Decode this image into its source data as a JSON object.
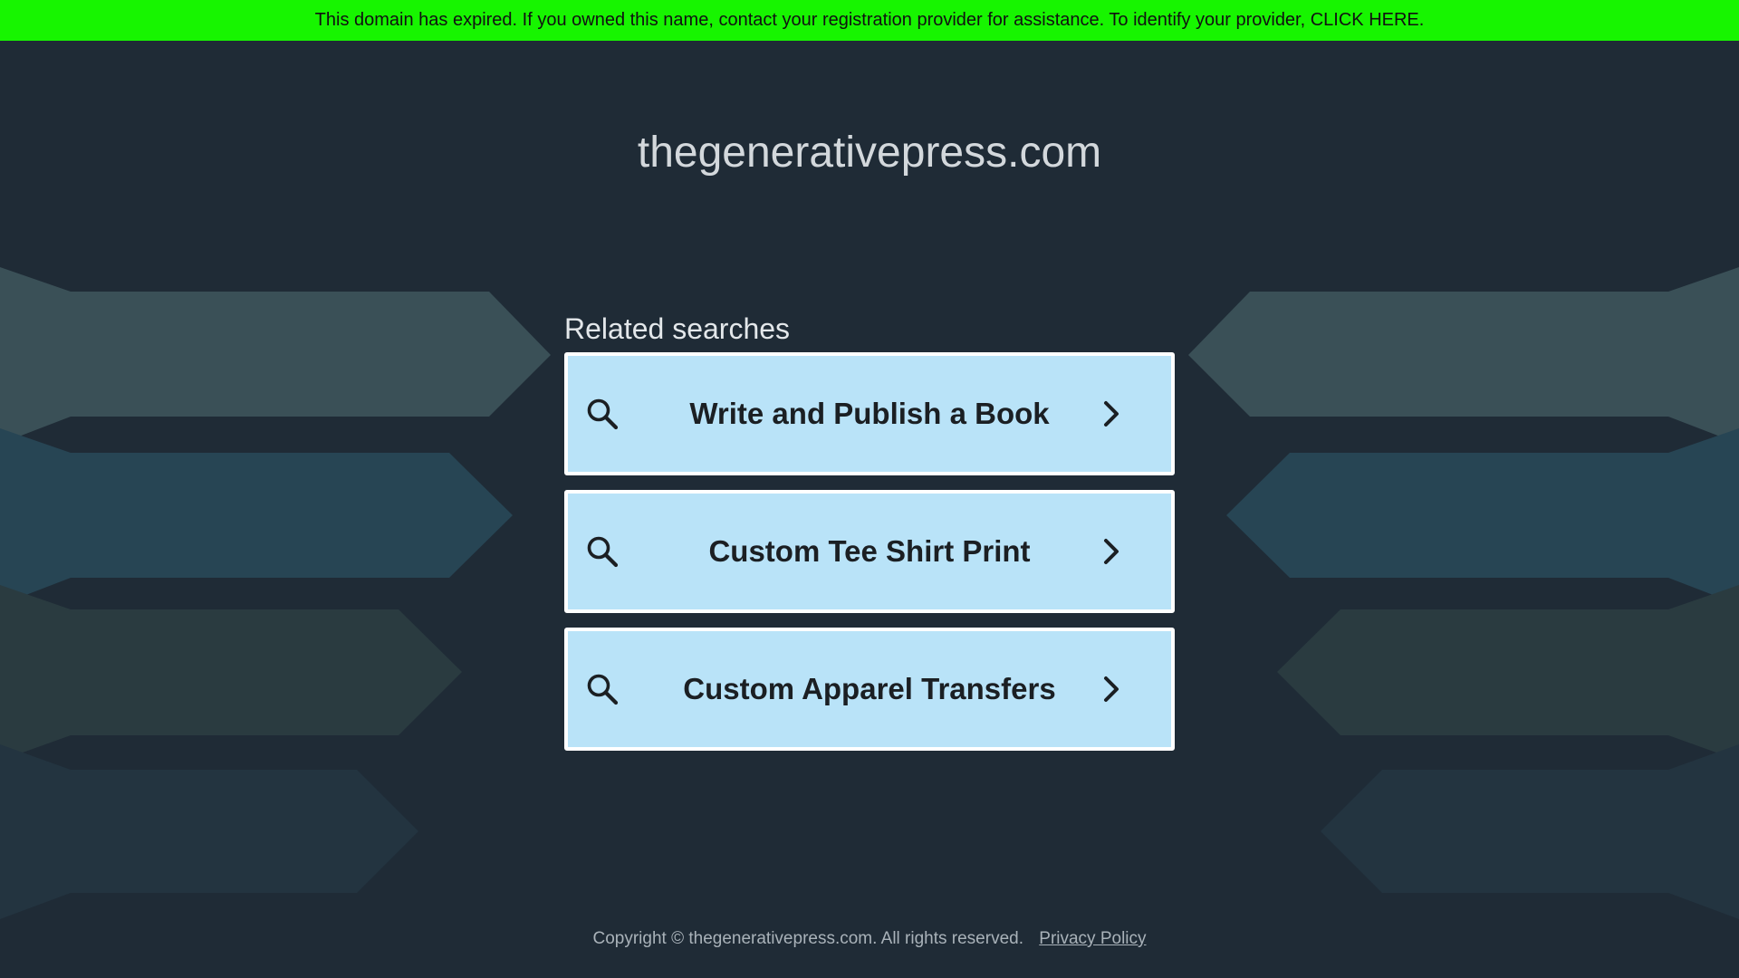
{
  "banner": {
    "text": "This domain has expired. If you owned this name, contact your registration provider for assistance. To identify your provider,",
    "link_label": "CLICK HERE."
  },
  "domain_title": "thegenerativepress.com",
  "related": {
    "heading": "Related searches",
    "items": [
      {
        "label": "Write and Publish a Book",
        "icon_left": "search-icon",
        "icon_right": "chevron-right-icon"
      },
      {
        "label": "Custom Tee Shirt Print",
        "icon_left": "search-icon",
        "icon_right": "chevron-right-icon"
      },
      {
        "label": "Custom Apparel Transfers",
        "icon_left": "search-icon",
        "icon_right": "chevron-right-icon"
      }
    ]
  },
  "footer": {
    "copyright": "Copyright © thegenerativepress.com.  All rights reserved.",
    "privacy_label": "Privacy Policy"
  },
  "colors": {
    "banner_bg": "#17f500",
    "page_bg": "#1f2b36",
    "card_bg": "#b9e3f8",
    "card_border": "#ffffff"
  }
}
